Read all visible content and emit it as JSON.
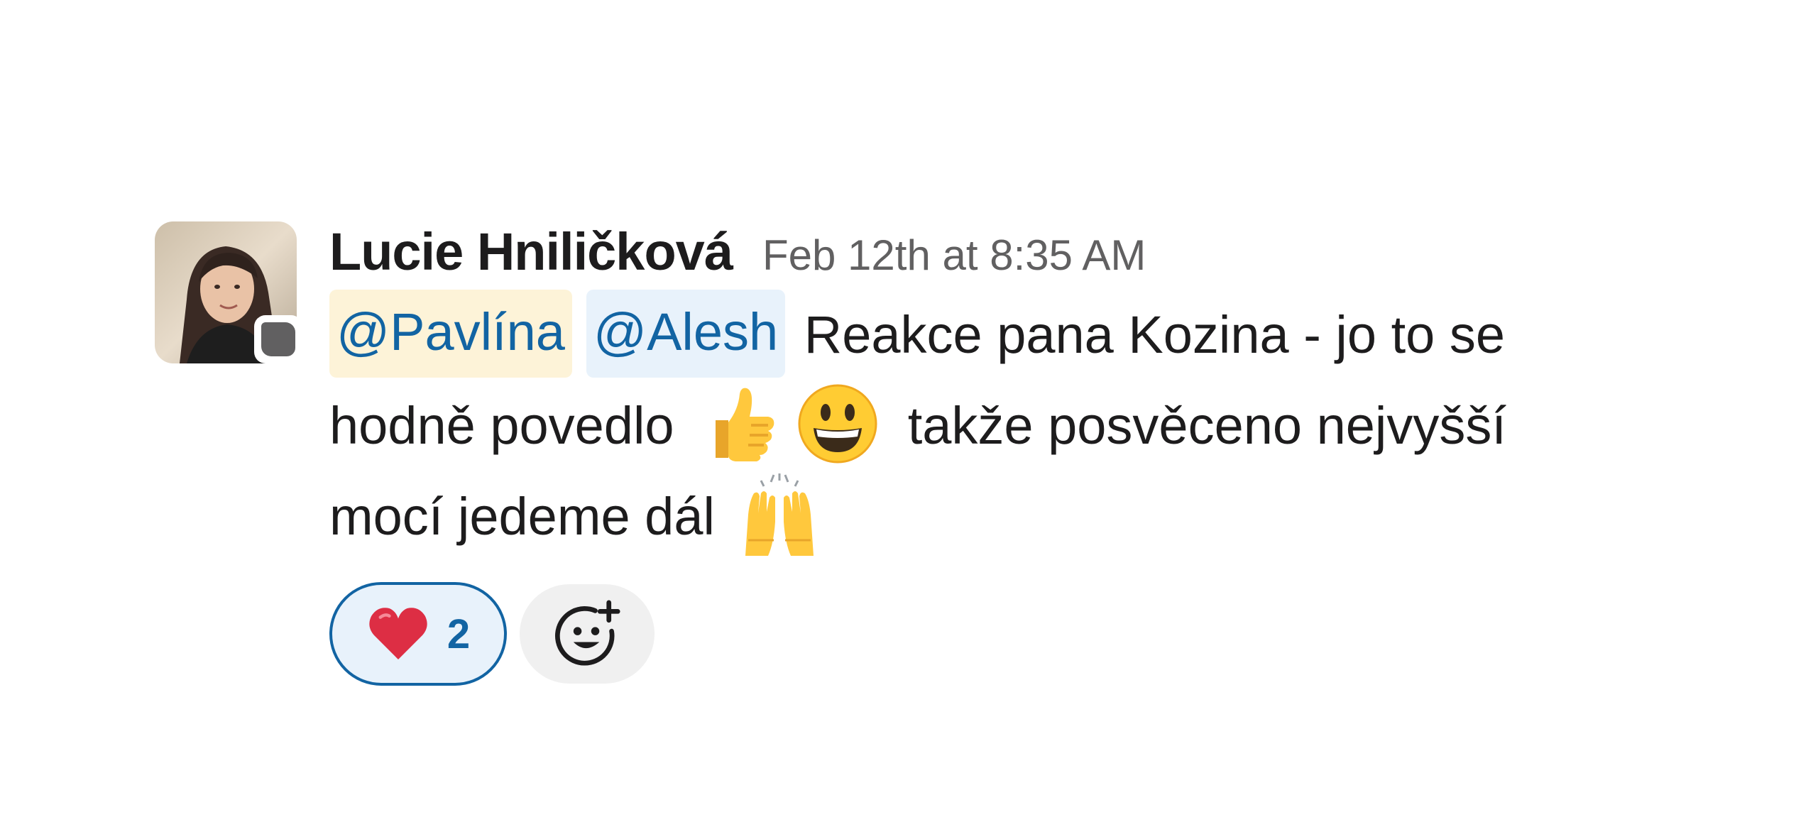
{
  "message": {
    "sender": "Lucie Hniličková",
    "timestamp": "Feb 12th at 8:35 AM",
    "mention_1": "@Pavlína",
    "mention_2": "@Alesh",
    "line_1_text": "Reakce pana Kozina - jo to se",
    "line_2_text_a": "hodně povedlo",
    "line_2_text_b": "takže posvěceno nejvyšší",
    "line_3_text": "mocí jedeme dál",
    "emojis": [
      "thumbs-up-icon",
      "smiley-icon",
      "raised-hands-icon"
    ]
  },
  "reactions": [
    {
      "emoji": "heart-icon",
      "count": "2"
    }
  ],
  "colors": {
    "mention_text": "#1264a3",
    "mention_self_bg": "#fdf3d8",
    "mention_other_bg": "#e8f2fb",
    "reaction_border": "#1264a3",
    "presence_away": "#616061"
  }
}
